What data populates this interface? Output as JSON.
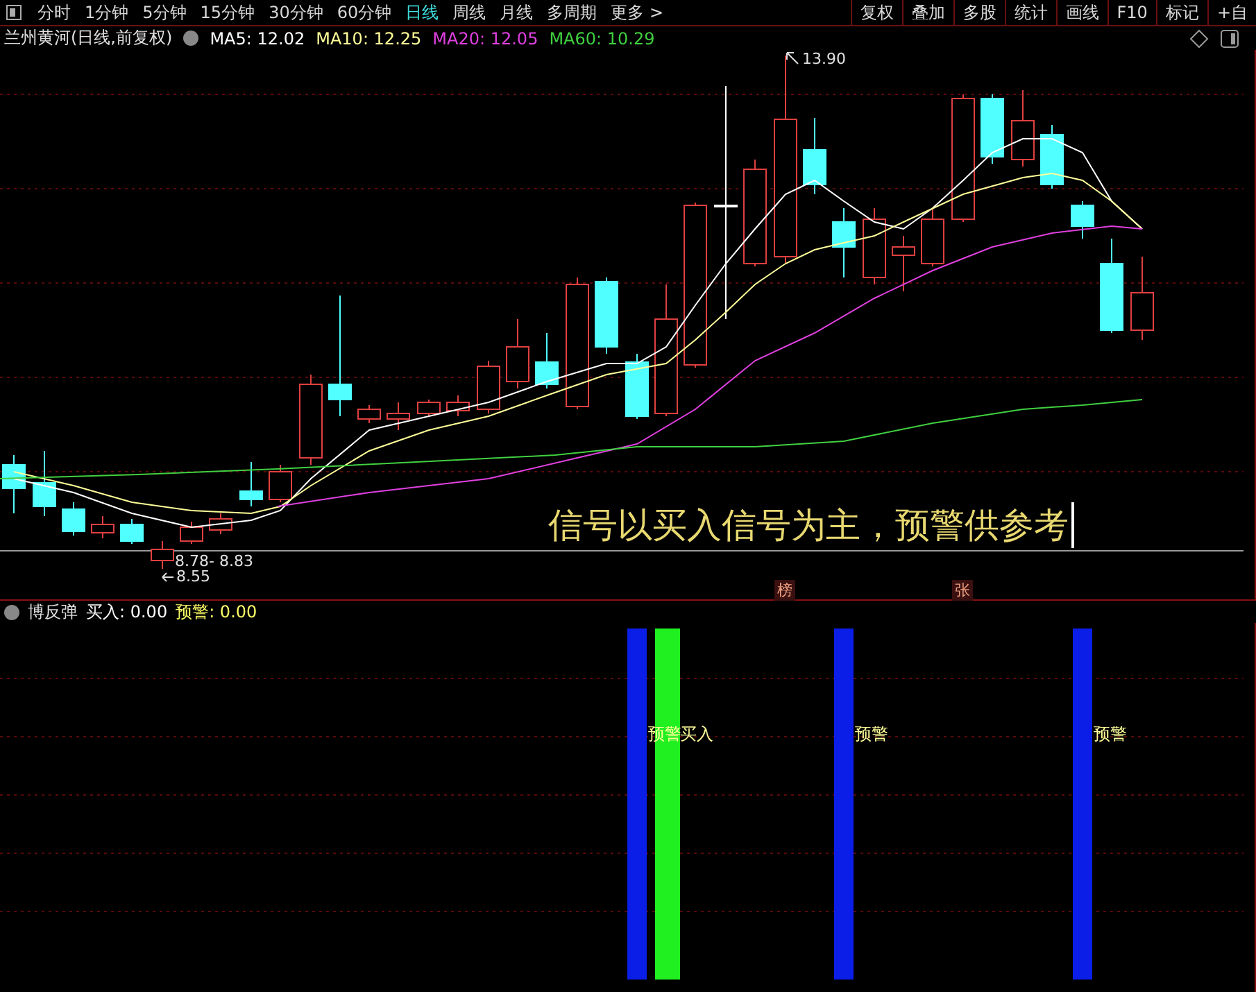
{
  "toolbar": {
    "tabs": [
      {
        "label": "分时",
        "selected": false
      },
      {
        "label": "1分钟",
        "selected": false
      },
      {
        "label": "5分钟",
        "selected": false
      },
      {
        "label": "15分钟",
        "selected": false
      },
      {
        "label": "30分钟",
        "selected": false
      },
      {
        "label": "60分钟",
        "selected": false
      },
      {
        "label": "日线",
        "selected": true
      },
      {
        "label": "周线",
        "selected": false
      },
      {
        "label": "月线",
        "selected": false
      },
      {
        "label": "多周期",
        "selected": false
      },
      {
        "label": "更多 >",
        "selected": false
      }
    ],
    "buttons": [
      "复权",
      "叠加",
      "多股",
      "统计",
      "画线",
      "F10",
      "标记",
      "+自"
    ]
  },
  "stock": {
    "name": "兰州黄河(日线,前复权)",
    "ma": [
      {
        "label": "MA5: 12.02",
        "color": "#ffffff"
      },
      {
        "label": "MA10: 12.25",
        "color": "#ffff99"
      },
      {
        "label": "MA20: 12.05",
        "color": "#e040e0"
      },
      {
        "label": "MA60: 10.29",
        "color": "#40d040"
      }
    ]
  },
  "price_chart": {
    "high_label": "13.90",
    "low_label": "8.55",
    "low_range": "8.78- 8.83",
    "note": "信号以买入信号为主，预警供参考",
    "markers": [
      "榜",
      "张"
    ]
  },
  "indicator": {
    "name": "博反弹",
    "values": [
      {
        "label": "买入: 0.00",
        "color": "#ffffff"
      },
      {
        "label": "预警: 0.00",
        "color": "#ffff66"
      }
    ]
  },
  "signals": [
    {
      "kind": "warning",
      "label": "预警"
    },
    {
      "kind": "buy",
      "label": "买入"
    },
    {
      "kind": "warning",
      "label": "预警"
    },
    {
      "kind": "warning",
      "label": "预警"
    }
  ]
}
